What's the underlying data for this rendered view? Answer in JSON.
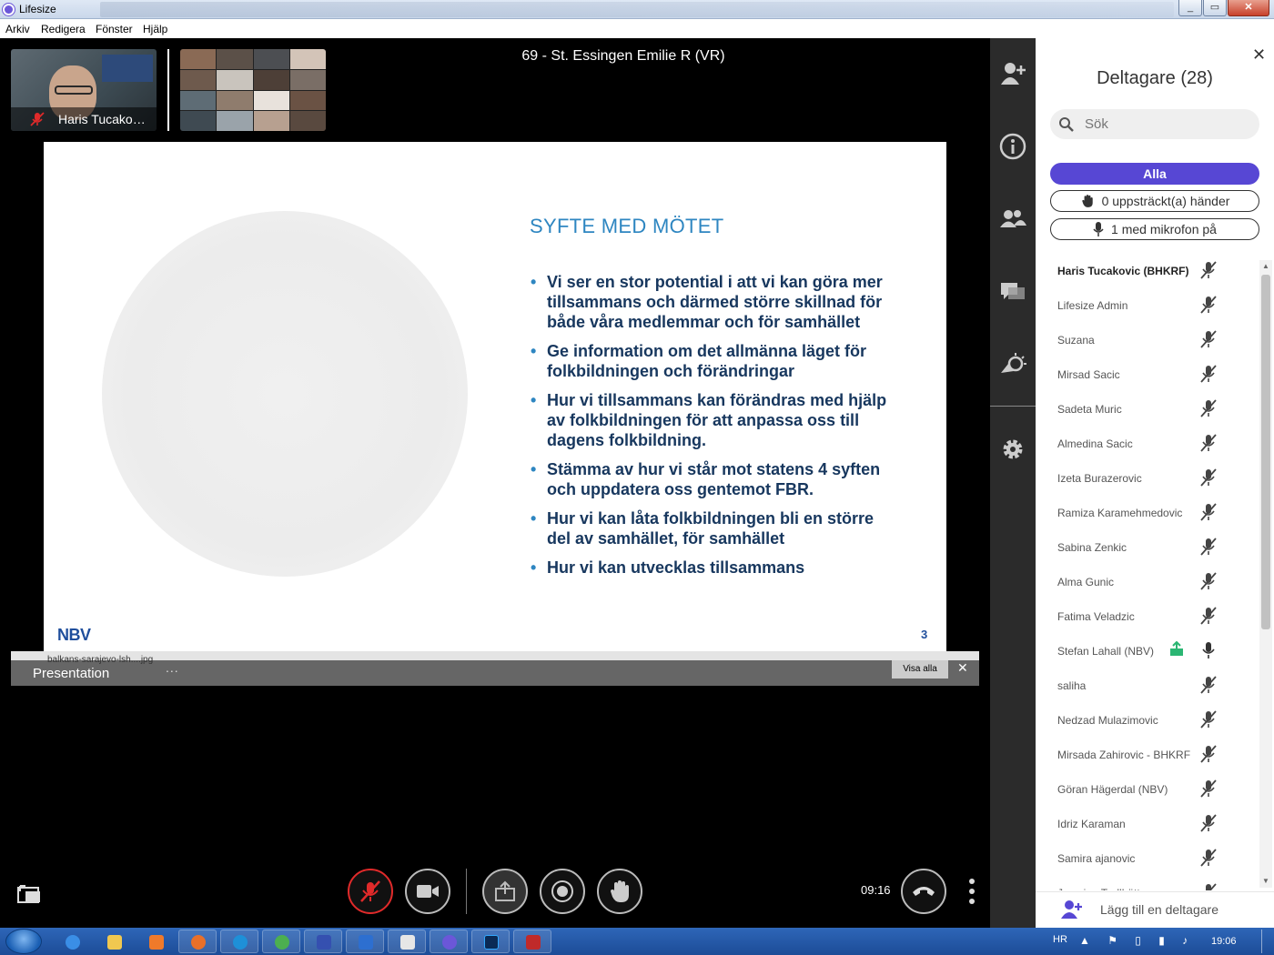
{
  "window": {
    "title": "Lifesize"
  },
  "menu": [
    "Arkiv",
    "Redigera",
    "Fönster",
    "Hjälp"
  ],
  "meeting": {
    "title": "69 - St. Essingen Emilie R (VR)",
    "self_name": "Haris Tucako…"
  },
  "slide": {
    "title": "SYFTE MED MÖTET",
    "bullets": [
      "Vi ser en stor potential i att vi kan göra mer tillsammans och därmed större skillnad för både våra medlemmar och för samhället",
      "Ge information om det allmänna läget för folkbildningen och förändringar",
      "Hur vi tillsammans kan förändras med hjälp av folkbildningen för att anpassa oss till dagens folkbildning.",
      "Stämma av hur vi står mot statens 4 syften och uppdatera oss gentemot FBR.",
      "Hur vi kan låta folkbildningen bli en större del av samhället, för samhället",
      "Hur vi kan utvecklas tillsammans"
    ],
    "logo": "NBV",
    "page": "3"
  },
  "presentation": {
    "file": "balkans-sarajevo-lsh....jpg",
    "label": "Presentation",
    "more": "...",
    "show_all": "Visa alla"
  },
  "controls": {
    "timer": "09:16"
  },
  "panel": {
    "title": "Deltagare (28)",
    "search_placeholder": "Sök",
    "filter_all": "Alla",
    "filter_hands": "0 uppsträckt(a) händer",
    "filter_mics": "1 med mikrofon på",
    "add_label": "Lägg till en deltagare",
    "participants": [
      {
        "name": "Haris Tucakovic (BHKRF)",
        "mic": "muted"
      },
      {
        "name": "Lifesize Admin",
        "mic": "muted"
      },
      {
        "name": "Suzana",
        "mic": "muted"
      },
      {
        "name": "Mirsad Sacic",
        "mic": "muted"
      },
      {
        "name": "Sadeta Muric",
        "mic": "muted"
      },
      {
        "name": "Almedina Sacic",
        "mic": "muted"
      },
      {
        "name": "Izeta Burazerovic",
        "mic": "muted"
      },
      {
        "name": "Ramiza Karamehmedovic",
        "mic": "muted"
      },
      {
        "name": "Sabina Zenkic",
        "mic": "muted"
      },
      {
        "name": "Alma Gunic",
        "mic": "muted"
      },
      {
        "name": "Fatima Veladzic",
        "mic": "muted"
      },
      {
        "name": "Stefan Lahall (NBV)",
        "mic": "on",
        "sharing": true
      },
      {
        "name": "saliha",
        "mic": "muted"
      },
      {
        "name": "Nedzad Mulazimovic",
        "mic": "muted"
      },
      {
        "name": "Mirsada Zahirovic - BHKRF",
        "mic": "muted"
      },
      {
        "name": "Göran Hägerdal (NBV)",
        "mic": "muted"
      },
      {
        "name": "Idriz Karaman",
        "mic": "muted"
      },
      {
        "name": "Samira ajanovic",
        "mic": "muted"
      },
      {
        "name": "Jasmina Trollhättan",
        "mic": "muted"
      }
    ]
  },
  "taskbar": {
    "lang": "HR",
    "clock": "19:06"
  },
  "colors": {
    "accent": "#5747d4",
    "mute_red": "#e02a2a",
    "slide_blue": "#17375e"
  }
}
